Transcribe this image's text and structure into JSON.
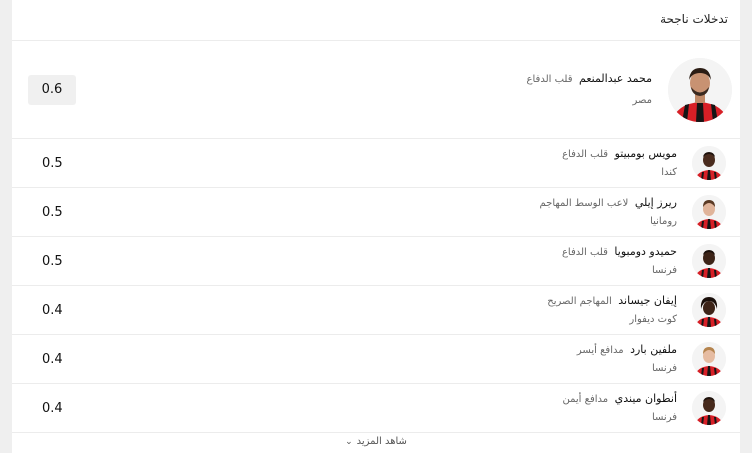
{
  "widget": {
    "title": "تدخلات ناجحة",
    "see_more": "شاهد المزيد",
    "see_more_icon": "chevron-down-icon"
  },
  "top_player": {
    "name": "محمد عبدالمنعم",
    "position": "قلب الدفاع",
    "country": "مصر",
    "value": "0.6"
  },
  "players": [
    {
      "name": "مويس بومبيتو",
      "position": "قلب الدفاع",
      "country": "كندا",
      "value": "0.5"
    },
    {
      "name": "ريرز إيلي",
      "position": "لاعب الوسط المهاجم",
      "country": "رومانيا",
      "value": "0.5"
    },
    {
      "name": "حميدو دومبويا",
      "position": "قلب الدفاع",
      "country": "فرنسا",
      "value": "0.5"
    },
    {
      "name": "إيفان جيساند",
      "position": "المهاجم الصريح",
      "country": "كوت ديفوار",
      "value": "0.4"
    },
    {
      "name": "ملفين بارد",
      "position": "مدافع أيسر",
      "country": "فرنسا",
      "value": "0.4"
    },
    {
      "name": "أنطوان ميندي",
      "position": "مدافع أيمن",
      "country": "فرنسا",
      "value": "0.4"
    }
  ],
  "colors": {
    "kit_red": "#d71f26",
    "kit_black": "#151515"
  }
}
